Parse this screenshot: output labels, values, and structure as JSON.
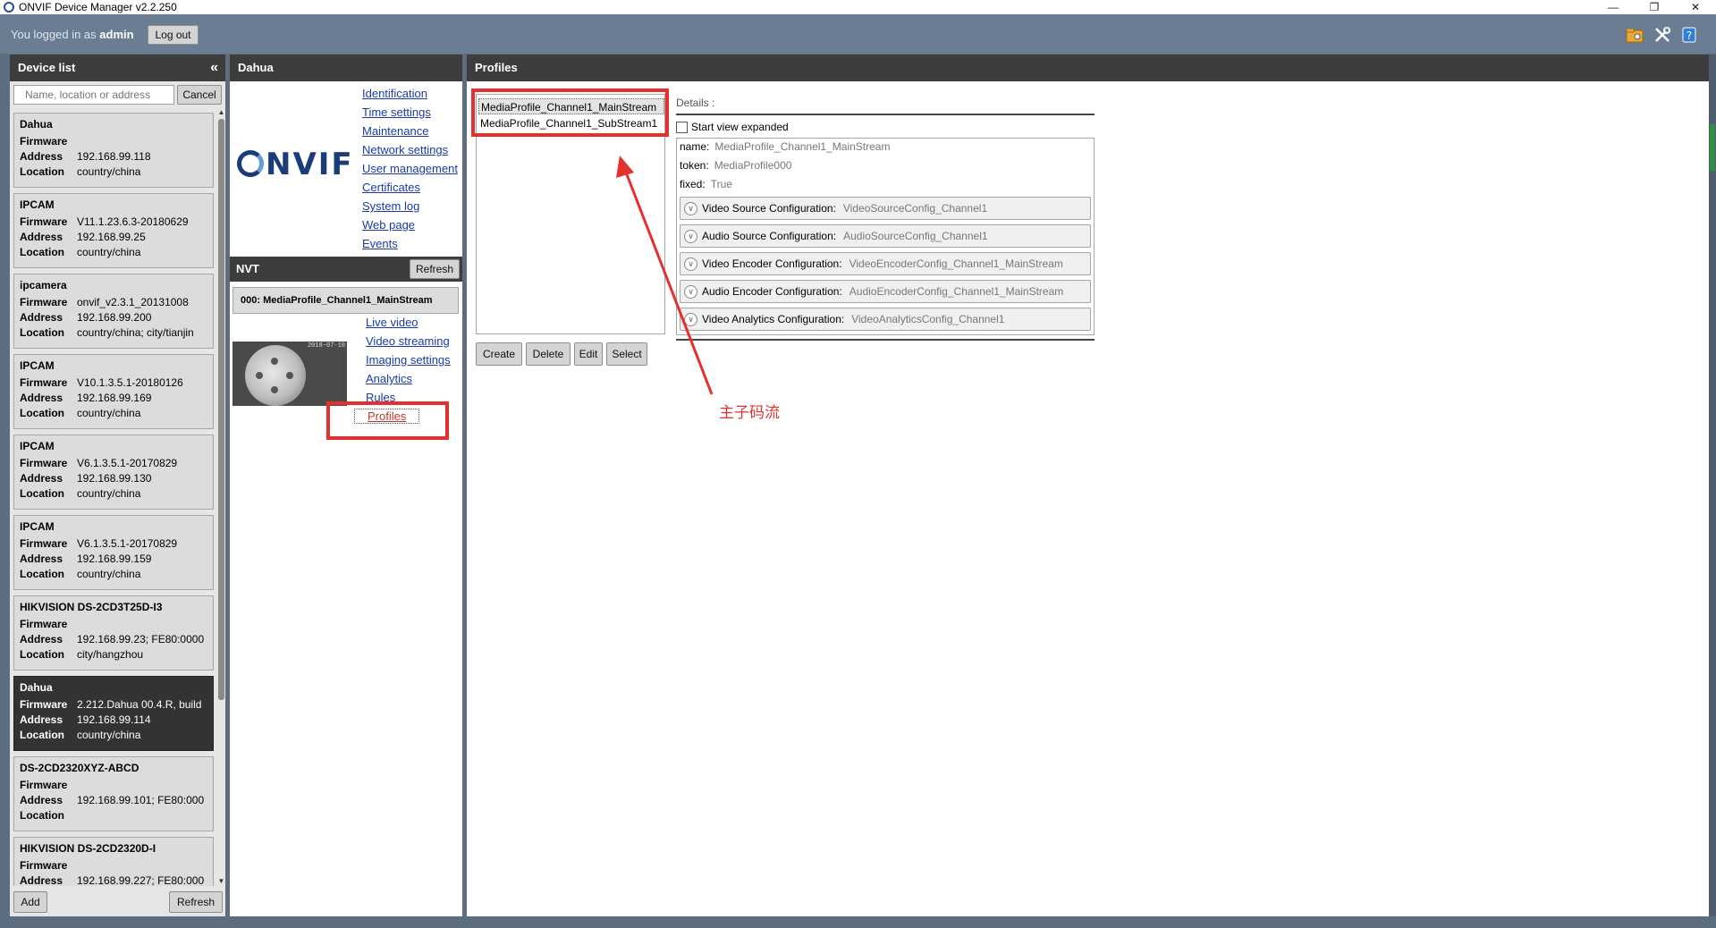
{
  "window": {
    "title": "ONVIF Device Manager v2.2.250",
    "minimize": "—",
    "restore": "❐",
    "close": "✕"
  },
  "topbar": {
    "logged_in_prefix": "You logged in as",
    "username": "admin",
    "logout_label": "Log out"
  },
  "device_panel": {
    "title": "Device list",
    "collapse_glyph": "«",
    "search_placeholder": "Name, location or address",
    "cancel_label": "Cancel",
    "add_label": "Add",
    "refresh_label": "Refresh",
    "field_labels": {
      "firmware": "Firmware",
      "address": "Address",
      "location": "Location"
    },
    "devices": [
      {
        "name": "Dahua",
        "firmware": "",
        "address": "192.168.99.118",
        "location": "country/china"
      },
      {
        "name": "IPCAM",
        "firmware": "V11.1.23.6.3-20180629",
        "address": "192.168.99.25",
        "location": "country/china"
      },
      {
        "name": "ipcamera",
        "firmware": "onvif_v2.3.1_20131008",
        "address": "192.168.99.200",
        "location": "country/china; city/tianjin"
      },
      {
        "name": "IPCAM",
        "firmware": "V10.1.3.5.1-20180126",
        "address": "192.168.99.169",
        "location": "country/china"
      },
      {
        "name": "IPCAM",
        "firmware": "V6.1.3.5.1-20170829",
        "address": "192.168.99.130",
        "location": "country/china"
      },
      {
        "name": "IPCAM",
        "firmware": "V6.1.3.5.1-20170829",
        "address": "192.168.99.159",
        "location": "country/china"
      },
      {
        "name": "HIKVISION DS-2CD3T25D-I3",
        "firmware": "",
        "address": "192.168.99.23; FE80:0000",
        "location": "city/hangzhou"
      },
      {
        "name": "Dahua",
        "firmware": "2.212.Dahua 00.4.R, build",
        "address": "192.168.99.114",
        "location": "country/china"
      },
      {
        "name": "DS-2CD2320XYZ-ABCD",
        "firmware": "",
        "address": "192.168.99.101; FE80:000",
        "location": ""
      },
      {
        "name": "HIKVISION DS-2CD2320D-I",
        "firmware": "",
        "address": "192.168.99.227; FE80:000",
        "location": ""
      }
    ]
  },
  "device_panel_selected_index": 7,
  "mid_panel": {
    "title": "Dahua",
    "logo_text": "NVIF",
    "links": [
      "Identification",
      "Time settings",
      "Maintenance",
      "Network settings",
      "User management",
      "Certificates",
      "System log",
      "Web page",
      "Events"
    ],
    "nvt_title": "NVT",
    "nvt_refresh_label": "Refresh",
    "profile_item": "000: MediaProfile_Channel1_MainStream",
    "thumb_timestamp": "2018-07-10",
    "profile_links": [
      "Live video",
      "Video streaming",
      "Imaging settings",
      "Analytics",
      "Rules",
      "Profiles"
    ]
  },
  "profiles_panel": {
    "title": "Profiles",
    "profiles": [
      "MediaProfile_Channel1_MainStream",
      "MediaProfile_Channel1_SubStream1"
    ],
    "details_label": "Details :",
    "start_expanded_label": "Start view expanded",
    "fields": [
      {
        "key": "name:",
        "value": "MediaProfile_Channel1_MainStream"
      },
      {
        "key": "token:",
        "value": "MediaProfile000"
      },
      {
        "key": "fixed:",
        "value": "True"
      }
    ],
    "configurations": [
      {
        "key": "Video Source Configuration:",
        "value": "VideoSourceConfig_Channel1"
      },
      {
        "key": "Audio Source Configuration:",
        "value": "AudioSourceConfig_Channel1"
      },
      {
        "key": "Video Encoder Configuration:",
        "value": "VideoEncoderConfig_Channel1_MainStream"
      },
      {
        "key": "Audio Encoder Configuration:",
        "value": "AudioEncoderConfig_Channel1_MainStream"
      },
      {
        "key": "Video Analytics Configuration:",
        "value": "VideoAnalyticsConfig_Channel1"
      }
    ],
    "buttons": {
      "create": "Create",
      "delete": "Delete",
      "edit": "Edit",
      "select": "Select"
    }
  },
  "annotation": {
    "text": "主子码流",
    "color": "#e53030"
  },
  "colors": {
    "background": "#5c6d80",
    "header": "#3d3d3d",
    "link": "#1b3aa8",
    "selected_card": "#333333"
  }
}
